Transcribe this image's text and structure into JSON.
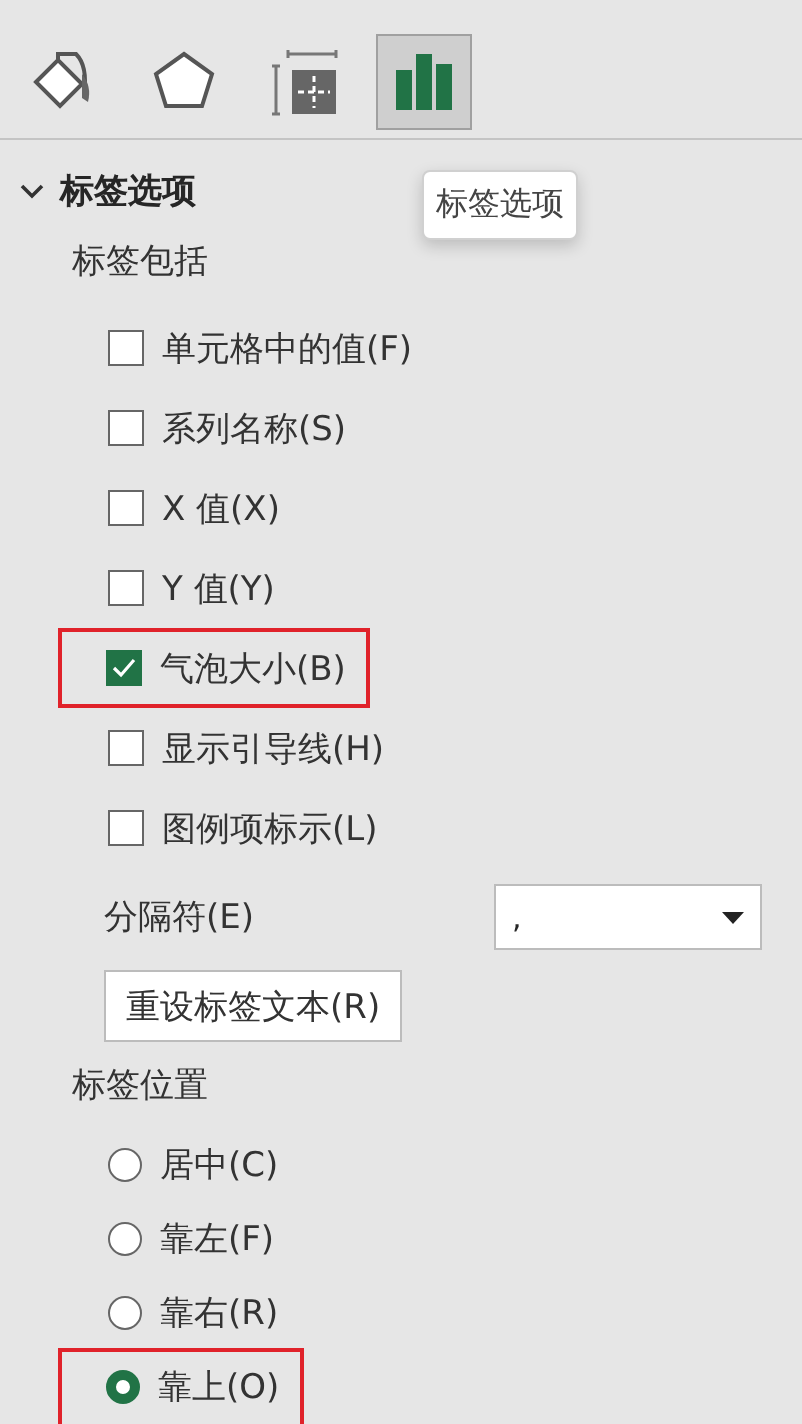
{
  "tabs": [
    {
      "kind": "fill",
      "selected": false
    },
    {
      "kind": "shape",
      "selected": false
    },
    {
      "kind": "size",
      "selected": false
    },
    {
      "kind": "chart",
      "selected": true
    }
  ],
  "tooltip": "标签选项",
  "section": {
    "title": "标签选项",
    "expanded": true
  },
  "include_title": "标签包括",
  "checkboxes": [
    {
      "label": "单元格中的值(F)",
      "checked": false,
      "highlighted": false
    },
    {
      "label": "系列名称(S)",
      "checked": false,
      "highlighted": false
    },
    {
      "label": "X 值(X)",
      "checked": false,
      "highlighted": false
    },
    {
      "label": "Y 值(Y)",
      "checked": false,
      "highlighted": false
    },
    {
      "label": "气泡大小(B)",
      "checked": true,
      "highlighted": true
    },
    {
      "label": "显示引导线(H)",
      "checked": false,
      "highlighted": false
    },
    {
      "label": "图例项标示(L)",
      "checked": false,
      "highlighted": false
    }
  ],
  "separator": {
    "label": "分隔符(E)",
    "value": ","
  },
  "reset_button": "重设标签文本(R)",
  "position_title": "标签位置",
  "positions": [
    {
      "label": "居中(C)",
      "selected": false,
      "highlighted": false
    },
    {
      "label": "靠左(F)",
      "selected": false,
      "highlighted": false
    },
    {
      "label": "靠右(R)",
      "selected": false,
      "highlighted": false
    },
    {
      "label": "靠上(O)",
      "selected": true,
      "highlighted": true
    }
  ]
}
